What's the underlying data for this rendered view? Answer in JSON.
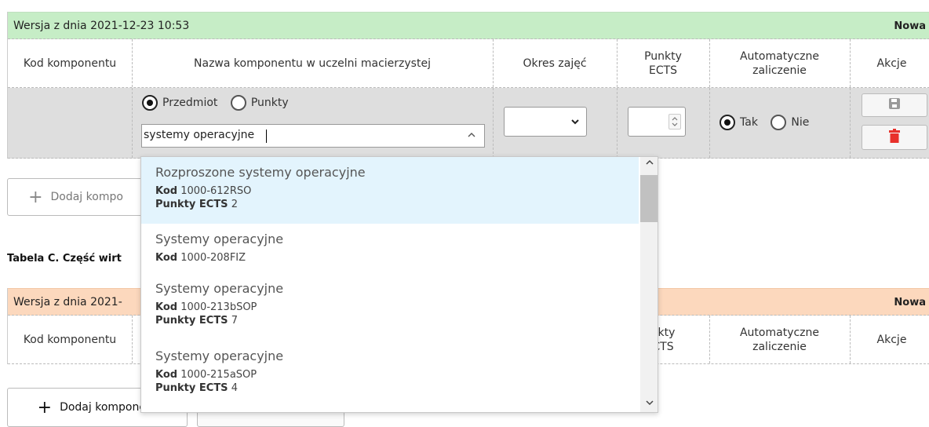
{
  "table_b": {
    "version": "Wersja z dnia 2021-12-23 10:53",
    "status": "Nowa",
    "columns": {
      "kod": "Kod komponentu",
      "nazwa": "Nazwa komponentu w uczelni macierzystej",
      "okres": "Okres zajęć",
      "ects_1": "Punkty",
      "ects_2": "ECTS",
      "auto_1": "Automatyczne",
      "auto_2": "zaliczenie",
      "akcje": "Akcje"
    },
    "edit_row": {
      "type_options": [
        "Przedmiot",
        "Punkty"
      ],
      "type_selected": "Przedmiot",
      "search_value": "systemy operacyjne",
      "auto_options": [
        "Tak",
        "Nie"
      ],
      "auto_selected": "Tak"
    },
    "add_button": "Dodaj kompo"
  },
  "section_c_title": "Tabela C. Część wirt",
  "table_c": {
    "version": "Wersja z dnia 2021-",
    "status": "Nowa",
    "columns": {
      "kod": "Kod komponentu",
      "ects_1": "nkty",
      "ects_2": "CTS",
      "auto_1": "Automatyczne",
      "auto_2": "zaliczenie",
      "akcje": "Akcje"
    },
    "add_button": "Dodaj kompo",
    "add_button_tail": "nent"
  },
  "autocomplete": {
    "kod_label": "Kod",
    "ects_label": "Punkty ECTS",
    "items": [
      {
        "name": "Rozproszone systemy operacyjne",
        "kod": "1000-612RSO",
        "ects": "2",
        "highlighted": true
      },
      {
        "name": "Systemy operacyjne",
        "kod": "1000-208FIZ"
      },
      {
        "name": "Systemy operacyjne",
        "kod": "1000-213bSOP",
        "ects": "7"
      },
      {
        "name": "Systemy operacyjne",
        "kod": "1000-215aSOP",
        "ects": "4"
      }
    ]
  },
  "colors": {
    "header_green": "#c6edc6",
    "header_orange": "#fcd8bd",
    "highlight": "#e3f4fd",
    "delete_red": "#e8312b"
  },
  "icons": [
    "save-icon",
    "trash-icon",
    "plus-icon",
    "chevron-down-icon",
    "chevron-up-icon",
    "spinner-icon"
  ]
}
